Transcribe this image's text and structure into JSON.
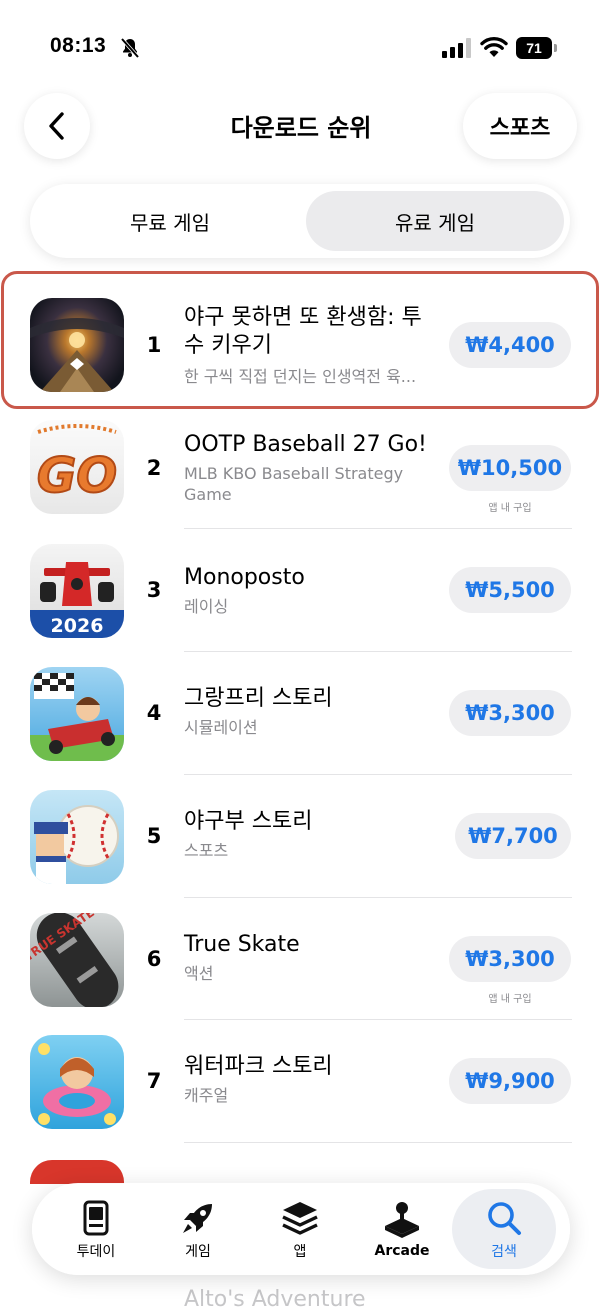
{
  "status": {
    "time": "08:13",
    "battery": "71"
  },
  "header": {
    "title": "다운로드 순위",
    "category": "스포츠"
  },
  "segments": {
    "free": "무료 게임",
    "paid": "유료 게임",
    "selected": "paid"
  },
  "apps": [
    {
      "rank": "1",
      "name": "야구 못하면 또 환생함: 투수 키우기",
      "subtitle": "한 구씩 직접 던지는 인생역전 육...",
      "price": "₩4,400",
      "iap": "",
      "icon": "stadium-icon"
    },
    {
      "rank": "2",
      "name": "OOTP Baseball 27 Go!",
      "subtitle": "MLB KBO Baseball Strategy Game",
      "price": "₩10,500",
      "iap": "앱 내 구입",
      "icon": "go-logo-icon"
    },
    {
      "rank": "3",
      "name": "Monoposto",
      "subtitle": "레이싱",
      "price": "₩5,500",
      "iap": "",
      "icon": "race-car-icon",
      "icon_text": "2026"
    },
    {
      "rank": "4",
      "name": "그랑프리 스토리",
      "subtitle": "시뮬레이션",
      "price": "₩3,300",
      "iap": "",
      "icon": "kart-racer-icon"
    },
    {
      "rank": "5",
      "name": "야구부 스토리",
      "subtitle": "스포츠",
      "price": "₩7,700",
      "iap": "",
      "icon": "baseball-player-icon"
    },
    {
      "rank": "6",
      "name": "True Skate",
      "subtitle": "액션",
      "price": "₩3,300",
      "iap": "앱 내 구입",
      "icon": "skateboard-icon",
      "icon_text": "TRUE SKATE"
    },
    {
      "rank": "7",
      "name": "워터파크 스토리",
      "subtitle": "캐주얼",
      "price": "₩9,900",
      "iap": "",
      "icon": "waterpark-icon"
    }
  ],
  "peek": {
    "next_title": "Alto's Adventure"
  },
  "tabbar": {
    "today": "투데이",
    "games": "게임",
    "apps": "앱",
    "arcade": "Arcade",
    "search": "검색",
    "active": "search"
  },
  "colors": {
    "accent": "#1f77e6",
    "highlight_border": "#c9584a",
    "price_bg": "#eeeef0"
  }
}
